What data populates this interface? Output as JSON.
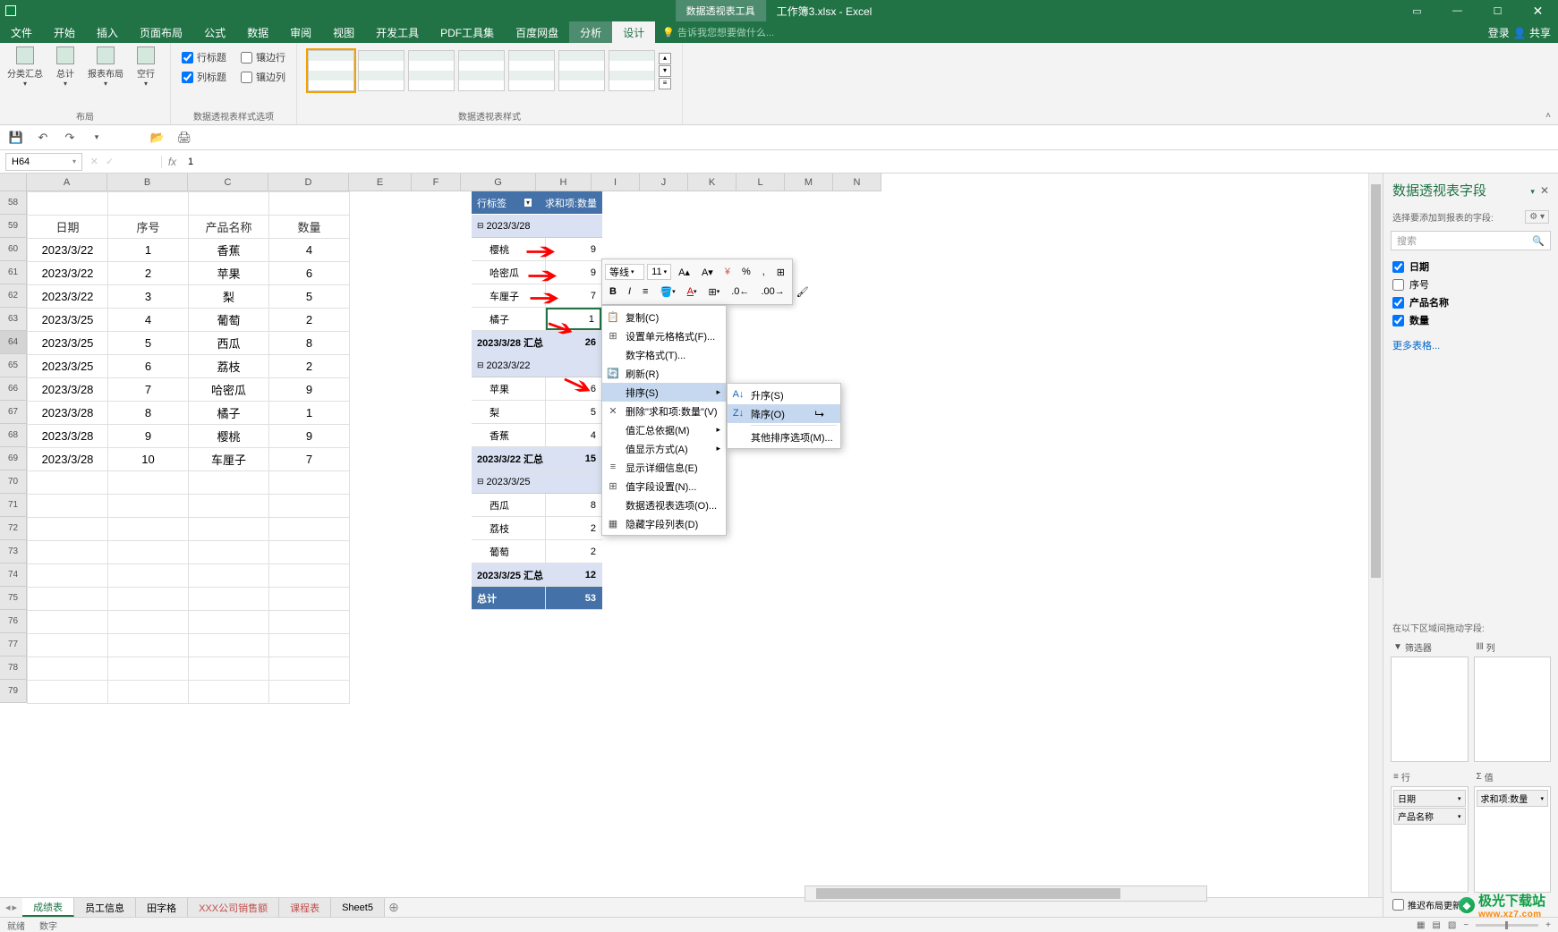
{
  "app": {
    "context_tab_title": "数据透视表工具",
    "doc_title": "工作簿3.xlsx - Excel",
    "login": "登录",
    "share": "共享"
  },
  "tabs": {
    "file": "文件",
    "home": "开始",
    "insert": "插入",
    "page_layout": "页面布局",
    "formulas": "公式",
    "data": "数据",
    "review": "审阅",
    "view": "视图",
    "developer": "开发工具",
    "pdf": "PDF工具集",
    "baidu": "百度网盘",
    "analyze": "分析",
    "design": "设计",
    "tell_me": "告诉我您想要做什么..."
  },
  "ribbon": {
    "layout": {
      "subtotals": "分类汇总",
      "grand_totals": "总计",
      "report_layout": "报表布局",
      "blank_rows": "空行",
      "group_label": "布局"
    },
    "style_options": {
      "row_headers": "行标题",
      "col_headers": "列标题",
      "banded_rows": "镶边行",
      "banded_cols": "镶边列",
      "group_label": "数据透视表样式选项"
    },
    "styles_group_label": "数据透视表样式"
  },
  "name_box": "H64",
  "formula_value": "1",
  "columns": [
    "A",
    "B",
    "C",
    "D",
    "E",
    "F",
    "G",
    "H",
    "I",
    "J",
    "K",
    "L",
    "M",
    "N"
  ],
  "rows_start": 58,
  "rows_end": 79,
  "data_headers": {
    "date": "日期",
    "seq": "序号",
    "product": "产品名称",
    "qty": "数量"
  },
  "data_rows": [
    {
      "date": "2023/3/22",
      "seq": "1",
      "product": "香蕉",
      "qty": "4"
    },
    {
      "date": "2023/3/22",
      "seq": "2",
      "product": "苹果",
      "qty": "6"
    },
    {
      "date": "2023/3/22",
      "seq": "3",
      "product": "梨",
      "qty": "5"
    },
    {
      "date": "2023/3/25",
      "seq": "4",
      "product": "葡萄",
      "qty": "2"
    },
    {
      "date": "2023/3/25",
      "seq": "5",
      "product": "西瓜",
      "qty": "8"
    },
    {
      "date": "2023/3/25",
      "seq": "6",
      "product": "荔枝",
      "qty": "2"
    },
    {
      "date": "2023/3/28",
      "seq": "7",
      "product": "哈密瓜",
      "qty": "9"
    },
    {
      "date": "2023/3/28",
      "seq": "8",
      "product": "橘子",
      "qty": "1"
    },
    {
      "date": "2023/3/28",
      "seq": "9",
      "product": "樱桃",
      "qty": "9"
    },
    {
      "date": "2023/3/28",
      "seq": "10",
      "product": "车厘子",
      "qty": "7"
    }
  ],
  "pivot": {
    "row_label": "行标签",
    "value_label": "求和项:数量",
    "groups": [
      {
        "date": "2023/3/28",
        "items": [
          {
            "name": "樱桃",
            "val": "9"
          },
          {
            "name": "哈密瓜",
            "val": "9"
          },
          {
            "name": "车厘子",
            "val": "7"
          },
          {
            "name": "橘子",
            "val": "1"
          }
        ],
        "subtotal_label": "2023/3/28 汇总",
        "subtotal_val": "26"
      },
      {
        "date": "2023/3/22",
        "items": [
          {
            "name": "苹果",
            "val": "6"
          },
          {
            "name": "梨",
            "val": "5"
          },
          {
            "name": "香蕉",
            "val": "4"
          }
        ],
        "subtotal_label": "2023/3/22 汇总",
        "subtotal_val": "15"
      },
      {
        "date": "2023/3/25",
        "items": [
          {
            "name": "西瓜",
            "val": "8"
          },
          {
            "name": "荔枝",
            "val": "2"
          },
          {
            "name": "葡萄",
            "val": "2"
          }
        ],
        "subtotal_label": "2023/3/25 汇总",
        "subtotal_val": "12"
      }
    ],
    "grand_label": "总计",
    "grand_val": "53"
  },
  "mini_toolbar": {
    "font": "等线",
    "size": "11"
  },
  "context_menu": {
    "copy": "复制(C)",
    "format_cells": "设置单元格格式(F)...",
    "number_format": "数字格式(T)...",
    "refresh": "刷新(R)",
    "sort": "排序(S)",
    "remove": "删除\"求和项:数量\"(V)",
    "summarize": "值汇总依据(M)",
    "show_as": "值显示方式(A)",
    "show_details": "显示详细信息(E)",
    "field_settings": "值字段设置(N)...",
    "pivot_options": "数据透视表选项(O)...",
    "hide_field_list": "隐藏字段列表(D)"
  },
  "sort_submenu": {
    "asc": "升序(S)",
    "desc": "降序(O)",
    "more": "其他排序选项(M)..."
  },
  "field_panel": {
    "title": "数据透视表字段",
    "subtitle": "选择要添加到报表的字段:",
    "search_placeholder": "搜索",
    "fields": [
      {
        "name": "日期",
        "checked": true
      },
      {
        "name": "序号",
        "checked": false
      },
      {
        "name": "产品名称",
        "checked": true
      },
      {
        "name": "数量",
        "checked": true
      }
    ],
    "more_tables": "更多表格...",
    "areas_label": "在以下区域间拖动字段:",
    "filters": "筛选器",
    "columns": "列",
    "rows": "行",
    "values": "值",
    "row_chips": [
      "日期",
      "产品名称"
    ],
    "value_chips": [
      "求和项:数量"
    ],
    "defer": "推迟布局更新"
  },
  "sheet_tabs": [
    "成绩表",
    "员工信息",
    "田字格",
    "XXX公司销售额",
    "课程表",
    "Sheet5"
  ],
  "active_sheet": 0,
  "status": {
    "ready": "就绪",
    "calc": "数字"
  },
  "watermark": {
    "text": "极光下载站",
    "url": "www.xz7.com"
  }
}
